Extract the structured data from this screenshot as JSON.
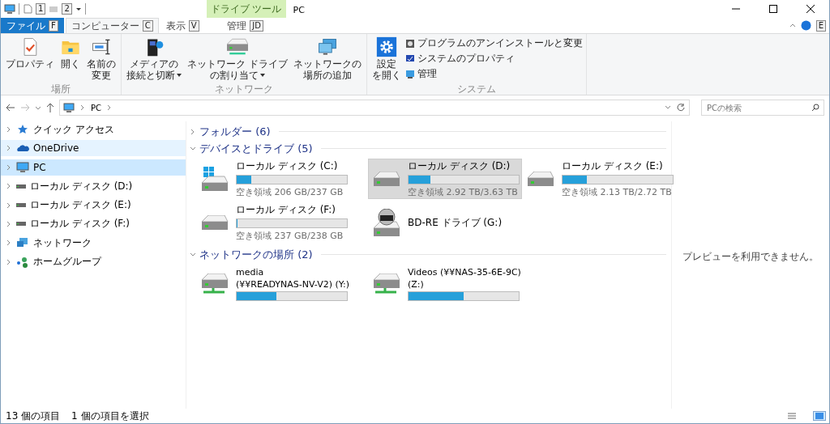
{
  "quick_access": {
    "keytips": [
      "1",
      "2"
    ]
  },
  "contextual_tab": {
    "label": "ドライブ ツール"
  },
  "window": {
    "title": "PC"
  },
  "tabs": [
    {
      "label": "ファイル",
      "kind": "file",
      "selected": false,
      "keytip": "F"
    },
    {
      "label": "コンピューター",
      "kind": "normal",
      "selected": true,
      "keytip": "C"
    },
    {
      "label": "表示",
      "kind": "normal",
      "selected": false,
      "keytip": "V"
    },
    {
      "label": "管理",
      "kind": "contextual",
      "selected": false,
      "keytip": "JD"
    }
  ],
  "help": {
    "keytip": "E"
  },
  "ribbon_groups": [
    {
      "label": "場所",
      "large": [
        {
          "kind": "properties",
          "lines": [
            "プロパティ"
          ]
        },
        {
          "kind": "folder",
          "lines": [
            "開く"
          ]
        },
        {
          "kind": "rename",
          "lines": [
            "名前の",
            "変更"
          ]
        }
      ]
    },
    {
      "label": "ネットワーク",
      "large": [
        {
          "kind": "media",
          "lines": [
            "メディアの",
            "接続と切断"
          ],
          "dropdown": true
        },
        {
          "kind": "netdrive",
          "lines": [
            "ネットワーク ドライブ",
            "の割り当て"
          ],
          "dropdown": true
        },
        {
          "kind": "netplace",
          "lines": [
            "ネットワークの",
            "場所の追加"
          ]
        }
      ]
    },
    {
      "label": "システム",
      "large": [
        {
          "kind": "settings",
          "lines": [
            "設定",
            "を開く"
          ]
        }
      ],
      "small": [
        {
          "kind": "uninstall",
          "label": "プログラムのアンインストールと変更"
        },
        {
          "kind": "sysprops",
          "label": "システムのプロパティ"
        },
        {
          "kind": "manage",
          "label": "管理"
        }
      ]
    }
  ],
  "address": {
    "path": [
      "PC"
    ]
  },
  "search": {
    "placeholder": "PCの検索"
  },
  "nav": [
    {
      "kind": "star",
      "label": "クイック アクセス",
      "selected": false,
      "hovered": false
    },
    {
      "kind": "cloud",
      "label": "OneDrive",
      "selected": false,
      "hovered": true
    },
    {
      "kind": "pc",
      "label": "PC",
      "selected": true,
      "hovered": false
    },
    {
      "kind": "drive",
      "label": "ローカル ディスク (D:)",
      "selected": false,
      "hovered": false
    },
    {
      "kind": "drive",
      "label": "ローカル ディスク (E:)",
      "selected": false,
      "hovered": false
    },
    {
      "kind": "drive",
      "label": "ローカル ディスク (F:)",
      "selected": false,
      "hovered": false
    },
    {
      "kind": "network",
      "label": "ネットワーク",
      "selected": false,
      "hovered": false
    },
    {
      "kind": "homegroup",
      "label": "ホームグループ",
      "selected": false,
      "hovered": false
    }
  ],
  "groups": [
    {
      "title": "フォルダー (6)",
      "expanded": false
    },
    {
      "title": "デバイスとドライブ (5)",
      "expanded": true,
      "items": [
        {
          "kind": "system",
          "lines": [
            "ローカル ディスク (C:)"
          ],
          "level": 0.13,
          "free": "空き領域 206 GB/237 GB",
          "selected": false
        },
        {
          "kind": "drive",
          "lines": [
            "ローカル ディスク (D:)"
          ],
          "level": 0.2,
          "free": "空き領域 2.92 TB/3.63 TB",
          "selected": true
        },
        {
          "kind": "drive",
          "lines": [
            "ローカル ディスク (E:)"
          ],
          "level": 0.22,
          "free": "空き領域 2.13 TB/2.72 TB",
          "selected": false
        },
        {
          "kind": "drive",
          "lines": [
            "ローカル ディスク (F:)"
          ],
          "level": 0.004,
          "free": "空き領域 237 GB/238 GB",
          "selected": false
        },
        {
          "kind": "optical",
          "lines": [
            "BD-RE ドライブ (G:)"
          ],
          "selected": false
        }
      ]
    },
    {
      "title": "ネットワークの場所 (2)",
      "expanded": true,
      "items": [
        {
          "kind": "netdrive",
          "lines": [
            "media",
            "(¥¥READYNAS-NV-V2) (Y:)"
          ],
          "level": 0.36,
          "selected": false
        },
        {
          "kind": "netdrive",
          "lines": [
            "Videos (¥¥NAS-35-6E-9C)",
            "(Z:)"
          ],
          "level": 0.5,
          "selected": false
        }
      ]
    }
  ],
  "preview": {
    "message": "プレビューを利用できません。"
  },
  "status": {
    "items": [
      "13 個の項目",
      "1 個の項目を選択"
    ],
    "views": [
      {
        "kind": "details",
        "selected": false
      },
      {
        "kind": "large",
        "selected": true
      }
    ]
  }
}
